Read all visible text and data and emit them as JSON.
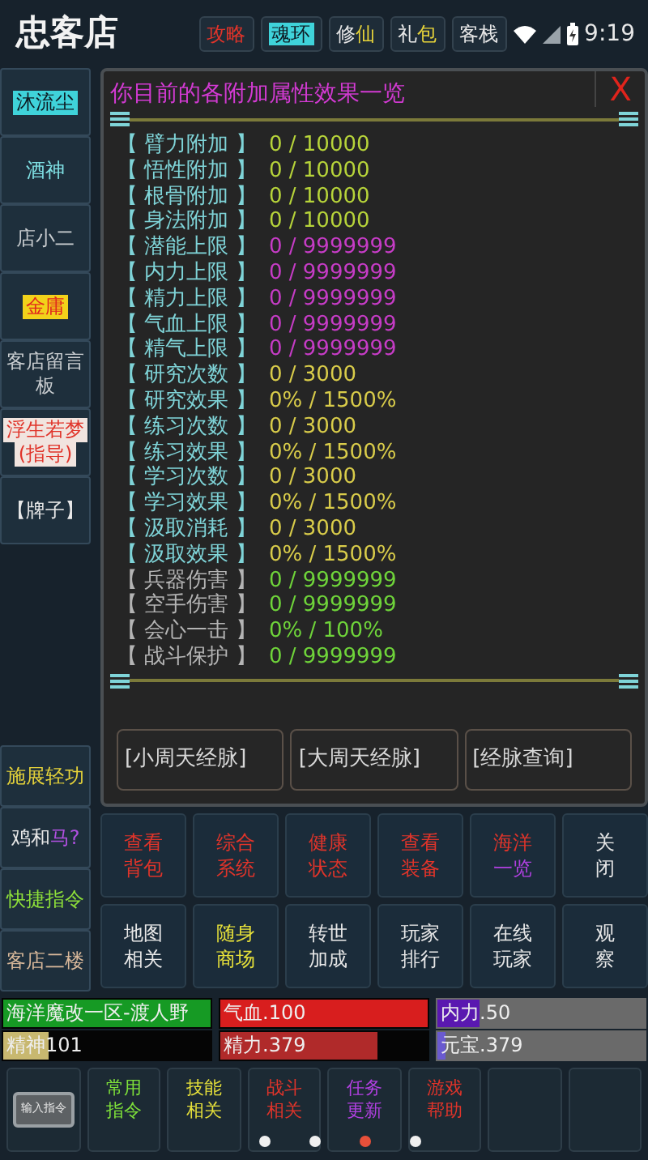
{
  "logo": "忠客店",
  "tabs": [
    {
      "lines": [
        [
          {
            "text": "攻略",
            "color": "#e0342a"
          }
        ]
      ],
      "selected": false
    },
    {
      "lines": [
        [
          {
            "text": "魂环"
          }
        ]
      ],
      "selected": true
    },
    {
      "lines": [
        [
          {
            "text": "修",
            "color": "#e8e8e8"
          },
          {
            "text": "仙",
            "color": "#e6d33a"
          }
        ]
      ],
      "selected": false
    },
    {
      "lines": [
        [
          {
            "text": "礼",
            "color": "#e8e8e8"
          },
          {
            "text": "包",
            "color": "#e6d33a"
          }
        ]
      ],
      "selected": false
    },
    {
      "lines": [
        [
          {
            "text": "客栈",
            "color": "#e8e8e8"
          }
        ]
      ],
      "selected": false
    }
  ],
  "status_bar": {
    "time": "9:19"
  },
  "sidebar": {
    "items": [
      {
        "lines": [
          [
            {
              "text": "沐流尘",
              "color": "#0e1a22"
            }
          ]
        ],
        "color": "#3fd3da"
      },
      {
        "lines": [
          [
            {
              "text": "酒神",
              "color": "#7fe0e4"
            }
          ]
        ]
      },
      {
        "lines": [
          [
            {
              "text": "店小二",
              "color": "#c9cdd0"
            }
          ]
        ]
      },
      {
        "lines": [
          [
            {
              "text": "金庸",
              "color": "#e0281e"
            }
          ]
        ],
        "color": "#f2d21a"
      },
      {
        "lines": [
          [
            {
              "text": "客店留言",
              "color": "#c9cdd0"
            }
          ],
          [
            {
              "text": "板",
              "color": "#c9cdd0"
            }
          ]
        ]
      },
      {
        "lines": [
          [
            {
              "text": "浮生若梦",
              "color": "#e0342a"
            }
          ],
          [
            {
              "text": "(指导)",
              "color": "#e0342a"
            }
          ]
        ],
        "color": "#f1e4df"
      },
      {
        "lines": [
          [
            {
              "text": "【牌子】",
              "color": "#e8e8e8"
            }
          ]
        ]
      }
    ],
    "bottom_items": [
      {
        "lines": [
          [
            {
              "text": "施展轻功",
              "color": "#e6d33a"
            }
          ]
        ]
      },
      {
        "lines": [
          [
            {
              "text": "鸡和",
              "color": "#e8e8e8"
            },
            {
              "text": "马?",
              "color": "#b050e0"
            }
          ]
        ]
      },
      {
        "lines": [
          [
            {
              "text": "快捷指令",
              "color": "#8ee03a"
            }
          ]
        ]
      },
      {
        "lines": [
          [
            {
              "text": "客店二楼",
              "color": "#d8b89a"
            }
          ]
        ]
      }
    ]
  },
  "panel": {
    "title": "你目前的各附加属性效果一览",
    "close": "X",
    "rows": [
      {
        "label": "【 臂力附加 】",
        "value": "0 / 10000",
        "kind": "primary",
        "color": "#b7d43a"
      },
      {
        "label": "【 悟性附加 】",
        "value": "0 / 10000",
        "kind": "primary",
        "color": "#b7d43a"
      },
      {
        "label": "【 根骨附加 】",
        "value": "0 / 10000",
        "kind": "primary",
        "color": "#b7d43a"
      },
      {
        "label": "【 身法附加 】",
        "value": "0 / 10000",
        "kind": "primary",
        "color": "#b7d43a"
      },
      {
        "label": "【 潜能上限 】",
        "value": "0 / 9999999",
        "kind": "primary",
        "color": "#c63cc6"
      },
      {
        "label": "【 内力上限 】",
        "value": "0 / 9999999",
        "kind": "primary",
        "color": "#c63cc6"
      },
      {
        "label": "【 精力上限 】",
        "value": "0 / 9999999",
        "kind": "primary",
        "color": "#c63cc6"
      },
      {
        "label": "【 气血上限 】",
        "value": "0 / 9999999",
        "kind": "primary",
        "color": "#c63cc6"
      },
      {
        "label": "【 精气上限 】",
        "value": "0 / 9999999",
        "kind": "primary",
        "color": "#c63cc6"
      },
      {
        "label": "【 研究次数 】",
        "value": "0 / 3000",
        "kind": "primary",
        "color": "#d9cc4a"
      },
      {
        "label": "【 研究效果 】",
        "value": "0% / 1500%",
        "kind": "primary",
        "color": "#d9cc4a"
      },
      {
        "label": "【 练习次数 】",
        "value": "0 / 3000",
        "kind": "primary",
        "color": "#d9cc4a"
      },
      {
        "label": "【 练习效果 】",
        "value": "0% / 1500%",
        "kind": "primary",
        "color": "#d9cc4a"
      },
      {
        "label": "【 学习次数 】",
        "value": "0 / 3000",
        "kind": "primary",
        "color": "#d9cc4a"
      },
      {
        "label": "【 学习效果 】",
        "value": "0% / 1500%",
        "kind": "primary",
        "color": "#d9cc4a"
      },
      {
        "label": "【 汲取消耗 】",
        "value": "0 / 3000",
        "kind": "primary",
        "color": "#d9cc4a"
      },
      {
        "label": "【 汲取效果 】",
        "value": "0% / 1500%",
        "kind": "primary",
        "color": "#d9cc4a"
      },
      {
        "label": "【 兵器伤害 】",
        "value": "0 / 9999999",
        "kind": "secondary",
        "color": "#6fd43a"
      },
      {
        "label": "【 空手伤害 】",
        "value": "0 / 9999999",
        "kind": "secondary",
        "color": "#6fd43a"
      },
      {
        "label": "【 会心一击 】",
        "value": "0% / 100%",
        "kind": "secondary",
        "color": "#6fd43a"
      },
      {
        "label": "【 战斗保护 】",
        "value": "0 / 9999999",
        "kind": "secondary",
        "color": "#6fd43a"
      }
    ],
    "buttons": [
      "[小周天经脉]",
      "[大周天经脉]",
      "[经脉查询]"
    ]
  },
  "menu_grid": [
    {
      "lines": [
        [
          {
            "text": "查看",
            "color": "#e0342a"
          }
        ],
        [
          {
            "text": "背包",
            "color": "#e0342a"
          }
        ]
      ]
    },
    {
      "lines": [
        [
          {
            "text": "综合",
            "color": "#e0342a"
          }
        ],
        [
          {
            "text": "系统",
            "color": "#e0342a"
          }
        ]
      ]
    },
    {
      "lines": [
        [
          {
            "text": "健康",
            "color": "#e0342a"
          }
        ],
        [
          {
            "text": "状态",
            "color": "#e0342a"
          }
        ]
      ]
    },
    {
      "lines": [
        [
          {
            "text": "查看",
            "color": "#e0342a"
          }
        ],
        [
          {
            "text": "装备",
            "color": "#e0342a"
          }
        ]
      ]
    },
    {
      "lines": [
        [
          {
            "text": "海洋",
            "color": "#e0342a"
          }
        ],
        [
          {
            "text": "一览",
            "color": "#b040e0"
          }
        ]
      ]
    },
    {
      "lines": [
        [
          {
            "text": "关",
            "color": "#e8e8e8"
          }
        ],
        [
          {
            "text": "闭",
            "color": "#e8e8e8"
          }
        ]
      ]
    },
    {
      "lines": [
        [
          {
            "text": "地图",
            "color": "#e8e8e8"
          }
        ],
        [
          {
            "text": "相关",
            "color": "#e8e8e8"
          }
        ]
      ]
    },
    {
      "lines": [
        [
          {
            "text": "随身",
            "color": "#e6e03a"
          }
        ],
        [
          {
            "text": "商场",
            "color": "#e6e03a"
          }
        ]
      ]
    },
    {
      "lines": [
        [
          {
            "text": "转世",
            "color": "#e8e8e8"
          }
        ],
        [
          {
            "text": "加成",
            "color": "#e8e8e8"
          }
        ]
      ]
    },
    {
      "lines": [
        [
          {
            "text": "玩家",
            "color": "#e8e8e8"
          }
        ],
        [
          {
            "text": "排行",
            "color": "#e8e8e8"
          }
        ]
      ]
    },
    {
      "lines": [
        [
          {
            "text": "在线",
            "color": "#e8e8e8"
          }
        ],
        [
          {
            "text": "玩家",
            "color": "#e8e8e8"
          }
        ]
      ]
    },
    {
      "lines": [
        [
          {
            "text": "观",
            "color": "#e8e8e8"
          }
        ],
        [
          {
            "text": "察",
            "color": "#e8e8e8"
          }
        ]
      ]
    }
  ],
  "stats": [
    {
      "text": "海洋魔改一区-渡人野",
      "color": "#169a24",
      "kind": "dark",
      "level": 1
    },
    {
      "text": "气血.100",
      "color": "#d81e1e",
      "kind": "dark",
      "level": 1
    },
    {
      "text": "内力.50",
      "color": "#5a18b0",
      "kind": "light",
      "level": 0.2
    },
    {
      "text": "精神101",
      "color": "#c8b870",
      "kind": "dark",
      "level": 0.22
    },
    {
      "text": "精力.379",
      "color": "#b02a2a",
      "kind": "dark",
      "level": 0.76
    },
    {
      "text": "元宝.379",
      "color": "#6a5ad0",
      "kind": "light",
      "level": 0.04
    }
  ],
  "toolbar": [
    {
      "kind": "image",
      "lines": [
        [
          {
            "text": "输入指令",
            "color": "#e8e8e8"
          }
        ]
      ]
    },
    {
      "kind": "text",
      "lines": [
        [
          {
            "text": "常用",
            "color": "#7ee03a"
          }
        ],
        [
          {
            "text": "指令",
            "color": "#7ee03a"
          }
        ]
      ]
    },
    {
      "kind": "text",
      "lines": [
        [
          {
            "text": "技能",
            "color": "#e6e03a"
          }
        ],
        [
          {
            "text": "相关",
            "color": "#e6e03a"
          }
        ]
      ]
    },
    {
      "kind": "text",
      "lines": [
        [
          {
            "text": "战斗",
            "color": "#e0342a"
          }
        ],
        [
          {
            "text": "相关",
            "color": "#e0342a"
          }
        ]
      ]
    },
    {
      "kind": "text",
      "lines": [
        [
          {
            "text": "任务",
            "color": "#b040e0"
          }
        ],
        [
          {
            "text": "更新",
            "color": "#b040e0"
          }
        ]
      ]
    },
    {
      "kind": "text",
      "lines": [
        [
          {
            "text": "游戏",
            "color": "#e0342a"
          }
        ],
        [
          {
            "text": "帮助",
            "color": "#e0342a"
          }
        ]
      ]
    },
    {
      "kind": "empty"
    },
    {
      "kind": "empty"
    }
  ],
  "page_dots": [
    {
      "selected": false
    },
    {
      "selected": false
    },
    {
      "selected": true
    },
    {
      "selected": false
    }
  ]
}
